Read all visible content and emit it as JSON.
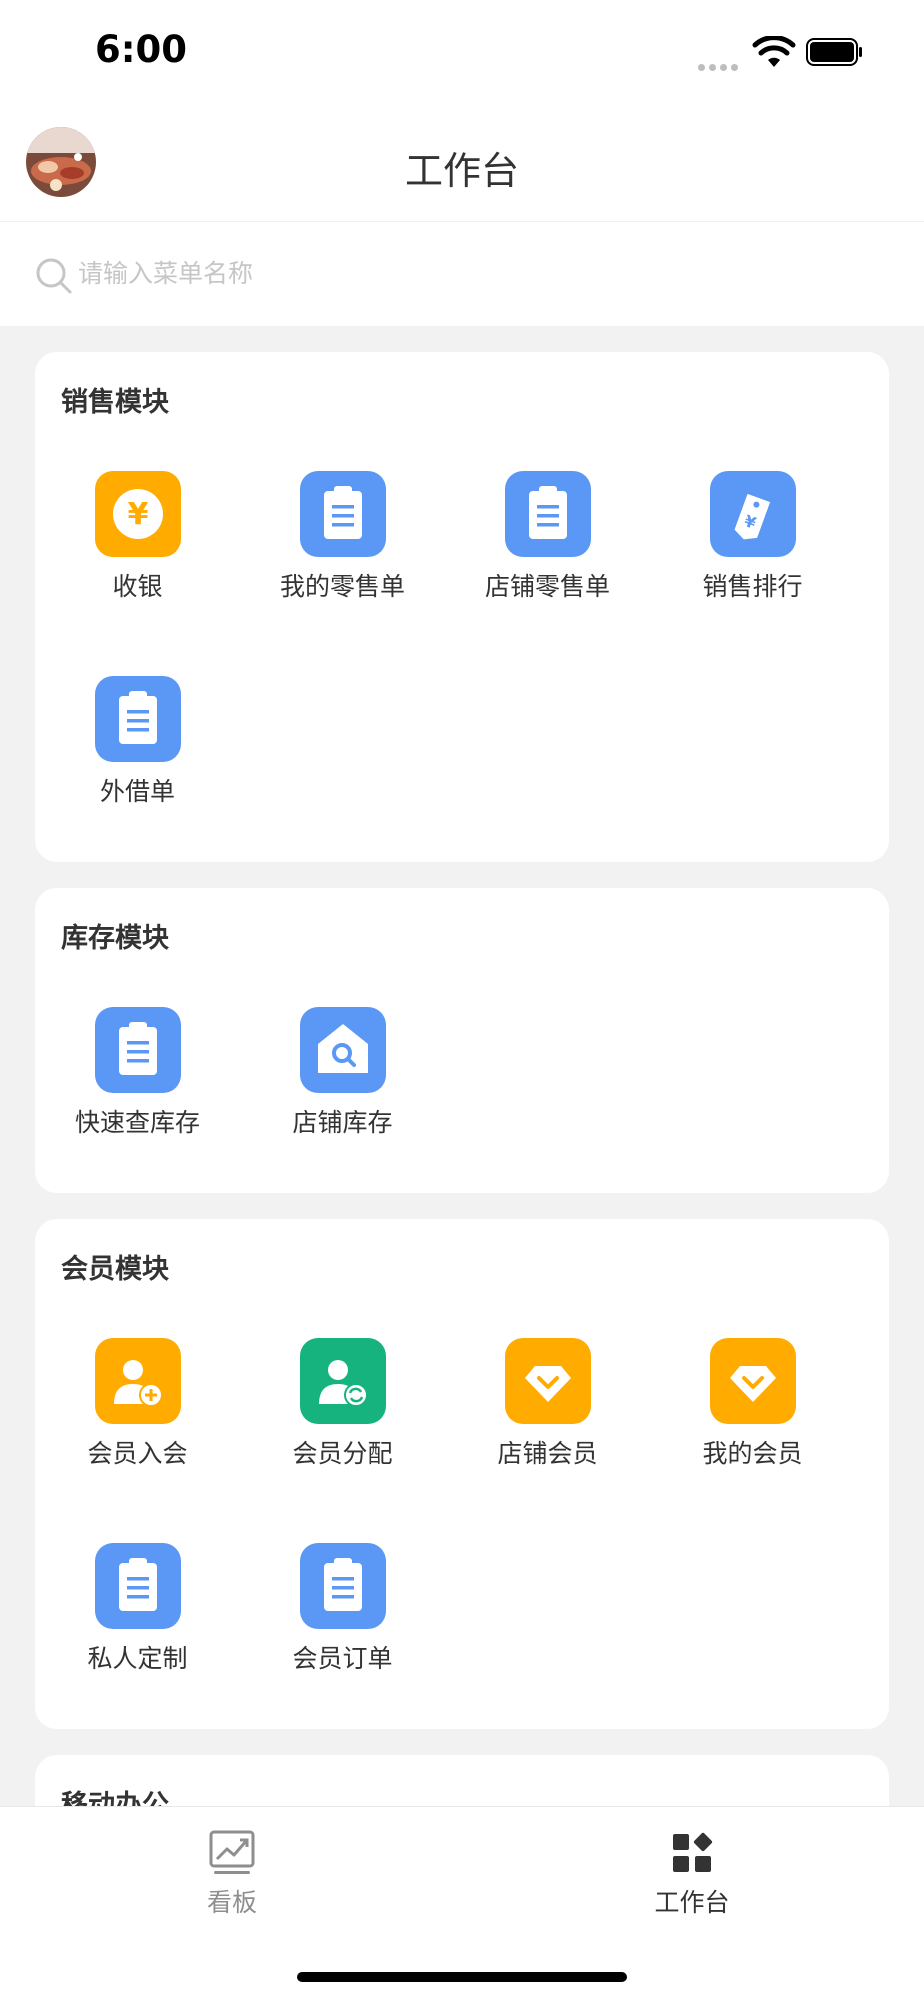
{
  "status_bar": {
    "time": "6:00"
  },
  "header": {
    "title": "工作台"
  },
  "search": {
    "placeholder": "请输入菜单名称"
  },
  "colors": {
    "blue": "#5b97f4",
    "orange": "#ffab00",
    "green": "#17b37e"
  },
  "sections": [
    {
      "title": "销售模块",
      "items": [
        {
          "label": "收银",
          "icon": "yen-coin-icon",
          "color": "orange"
        },
        {
          "label": "我的零售单",
          "icon": "clipboard-icon",
          "color": "blue"
        },
        {
          "label": "店铺零售单",
          "icon": "clipboard-icon",
          "color": "blue"
        },
        {
          "label": "销售排行",
          "icon": "price-tag-icon",
          "color": "blue"
        },
        {
          "label": "外借单",
          "icon": "clipboard-icon",
          "color": "blue"
        }
      ]
    },
    {
      "title": "库存模块",
      "items": [
        {
          "label": "快速查库存",
          "icon": "clipboard-icon",
          "color": "blue"
        },
        {
          "label": "店铺库存",
          "icon": "store-search-icon",
          "color": "blue"
        }
      ]
    },
    {
      "title": "会员模块",
      "items": [
        {
          "label": "会员入会",
          "icon": "user-add-icon",
          "color": "orange"
        },
        {
          "label": "会员分配",
          "icon": "user-transfer-icon",
          "color": "green"
        },
        {
          "label": "店铺会员",
          "icon": "diamond-icon",
          "color": "orange"
        },
        {
          "label": "我的会员",
          "icon": "diamond-icon",
          "color": "orange"
        },
        {
          "label": "私人定制",
          "icon": "clipboard-icon",
          "color": "blue"
        },
        {
          "label": "会员订单",
          "icon": "clipboard-icon",
          "color": "blue"
        }
      ]
    },
    {
      "title": "移动办公",
      "items": []
    }
  ],
  "tab_bar": {
    "tabs": [
      {
        "label": "看板",
        "icon": "chart-trend-icon",
        "active": false
      },
      {
        "label": "工作台",
        "icon": "grid-apps-icon",
        "active": true
      }
    ]
  }
}
